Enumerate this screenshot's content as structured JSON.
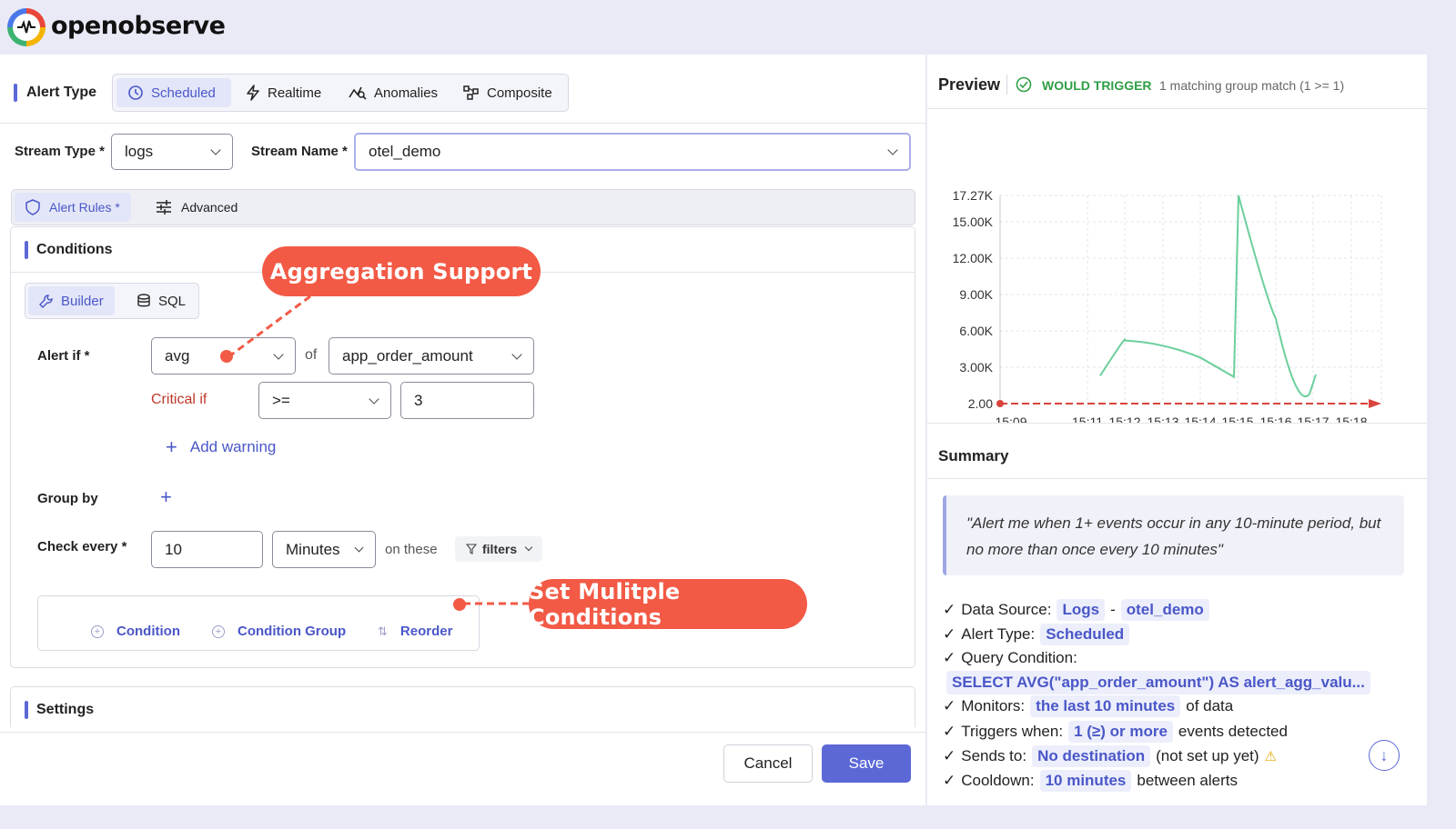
{
  "app": {
    "name": "openobserve"
  },
  "alert_type": {
    "label": "Alert Type",
    "options": [
      {
        "label": "Scheduled",
        "icon": "clock-icon",
        "active": true
      },
      {
        "label": "Realtime",
        "icon": "bolt-icon",
        "active": false
      },
      {
        "label": "Anomalies",
        "icon": "anomaly-icon",
        "active": false
      },
      {
        "label": "Composite",
        "icon": "composite-icon",
        "active": false
      }
    ]
  },
  "stream": {
    "type_label": "Stream Type *",
    "type_value": "logs",
    "name_label": "Stream Name *",
    "name_value": "otel_demo"
  },
  "tabs": [
    {
      "label": "Alert Rules *",
      "icon": "shield-icon",
      "active": true
    },
    {
      "label": "Advanced",
      "icon": "sliders-icon",
      "active": false
    }
  ],
  "conditions": {
    "title": "Conditions",
    "mode_builder": "Builder",
    "mode_sql": "SQL",
    "alert_if_label": "Alert if *",
    "agg_value": "avg",
    "of_label": "of",
    "field_value": "app_order_amount",
    "critical_label": "Critical if",
    "operator_value": ">=",
    "threshold_value": "3",
    "add_warning": "Add warning",
    "group_by_label": "Group by",
    "check_every_label": "Check every *",
    "check_every_value": "10",
    "check_unit": "Minutes",
    "on_these": "on these",
    "filters": "filters",
    "add_condition": "Condition",
    "add_condition_group": "Condition Group",
    "reorder": "Reorder"
  },
  "callouts": {
    "aggregation": "Aggregation Support",
    "multiple": "Set  Mulitple Conditions"
  },
  "settings": {
    "title": "Settings"
  },
  "footer": {
    "cancel": "Cancel",
    "save": "Save"
  },
  "preview": {
    "title": "Preview",
    "status": "WOULD TRIGGER",
    "status_detail": "1 matching group match (1 >= 1)",
    "status_color": "#2f9e44"
  },
  "chart_data": {
    "type": "line",
    "y_ticks": [
      "17.27K",
      "15.00K",
      "12.00K",
      "9.00K",
      "6.00K",
      "3.00K",
      "2.00"
    ],
    "x_ticks": [
      "15:09",
      "15:11",
      "15:12",
      "15:13",
      "15:14",
      "15:15",
      "15:16",
      "15:17",
      "15:18"
    ],
    "ylim": [
      2,
      17270
    ],
    "series": [
      {
        "values": [
          [
            "15:11",
            2300
          ],
          [
            "15:12",
            5200
          ],
          [
            "15:13",
            4800
          ],
          [
            "15:14",
            3800
          ],
          [
            "15:15",
            2200
          ],
          [
            "15:15",
            17270
          ],
          [
            "15:16",
            7000
          ],
          [
            "15:17",
            800
          ],
          [
            "15:17",
            2400
          ]
        ],
        "color": "#6ccf9c"
      }
    ],
    "threshold": {
      "value": 3,
      "color": "#d9443c"
    }
  },
  "summary": {
    "title": "Summary",
    "quote": "\"Alert me when 1+ events occur in any 10-minute period, but no more than once every 10 minutes\"",
    "lines": {
      "data_source_label": "Data Source:",
      "data_source_type": "Logs",
      "dash": "-",
      "data_source_stream": "otel_demo",
      "alert_type_label": "Alert Type:",
      "alert_type_value": "Scheduled",
      "query_label": "Query Condition:",
      "query_value": "SELECT AVG(\"app_order_amount\") AS alert_agg_valu...",
      "monitors_label": "Monitors:",
      "monitors_value": "the last 10 minutes",
      "monitors_suffix": "of data",
      "triggers_label": "Triggers when:",
      "triggers_value": "1 (≥) or more",
      "triggers_suffix": "events detected",
      "sends_label": "Sends to:",
      "sends_value": "No destination",
      "sends_suffix": "(not set up yet)",
      "cooldown_label": "Cooldown:",
      "cooldown_value": "10 minutes",
      "cooldown_suffix": "between alerts"
    },
    "check": "✓"
  }
}
